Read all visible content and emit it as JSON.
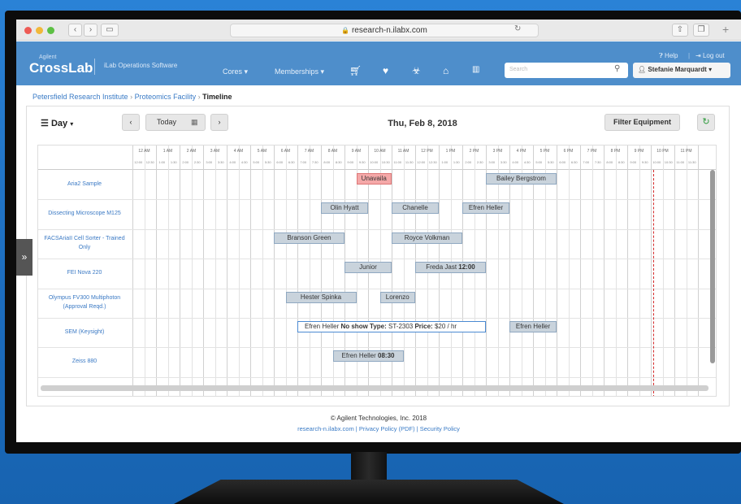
{
  "browser": {
    "url": "research-n.ilabx.com"
  },
  "app": {
    "brand_small": "Agilent",
    "brand": "CrossLab",
    "tagline": "iLab Operations Software",
    "nav": {
      "cores": "Cores",
      "memberships": "Memberships"
    },
    "help": "Help",
    "logout": "Log out",
    "search_placeholder": "Search",
    "user": "Stefanie Marquardt"
  },
  "breadcrumb": {
    "institute": "Petersfield Research Institute",
    "facility": "Proteomics Facility",
    "current": "Timeline"
  },
  "toolbar": {
    "view": "Day",
    "today": "Today",
    "date": "Thu, Feb 8, 2018",
    "filter": "Filter Equipment"
  },
  "timeline": {
    "hours": [
      "12 AM",
      "1 AM",
      "2 AM",
      "3 AM",
      "4 AM",
      "5 AM",
      "6 AM",
      "7 AM",
      "8 AM",
      "9 AM",
      "10 AM",
      "11 AM",
      "12 PM",
      "1 PM",
      "2 PM",
      "3 PM",
      "4 PM",
      "5 PM",
      "6 PM",
      "7 PM",
      "8 PM",
      "9 PM",
      "10 PM",
      "11 PM"
    ],
    "halves": [
      "12:00",
      "12:30",
      "1:00",
      "1:30",
      "2:00",
      "2:30",
      "3:00",
      "3:30",
      "4:00",
      "4:30",
      "5:00",
      "5:30",
      "6:00",
      "6:30",
      "7:00",
      "7:30",
      "8:00",
      "8:30",
      "9:00",
      "9:30",
      "10:00",
      "10:30",
      "11:00",
      "11:30",
      "12:00",
      "12:30",
      "1:00",
      "1:30",
      "2:00",
      "2:30",
      "3:00",
      "3:30",
      "4:00",
      "4:30",
      "5:00",
      "5:30",
      "6:00",
      "6:30",
      "7:00",
      "7:30",
      "8:00",
      "8:30",
      "9:00",
      "9:30",
      "10:00",
      "10:30",
      "11:00",
      "11:30"
    ],
    "resources": [
      {
        "name": "Aria2 Sample"
      },
      {
        "name": "Dissecting Microscope M125"
      },
      {
        "name": "FACSAriaII Cell Sorter - Trained Only"
      },
      {
        "name": "FEI Nova 220"
      },
      {
        "name": "Olympus FV300 Multiphoton (Approval Reqd.)"
      },
      {
        "name": "SEM (Keysight)"
      },
      {
        "name": "Zeiss 880"
      }
    ],
    "bookings": [
      {
        "row": 0,
        "start": 9.5,
        "end": 11.0,
        "text": "Unavaila",
        "style": "red"
      },
      {
        "row": 0,
        "start": 15.0,
        "end": 18.0,
        "text": "Bailey Bergstrom"
      },
      {
        "row": 1,
        "start": 8.0,
        "end": 10.0,
        "text": "Olin Hyatt"
      },
      {
        "row": 1,
        "start": 11.0,
        "end": 13.0,
        "text": "Chanelle"
      },
      {
        "row": 1,
        "start": 14.0,
        "end": 16.0,
        "text": "Efren Heller"
      },
      {
        "row": 2,
        "start": 6.0,
        "end": 9.0,
        "text": "Branson Green"
      },
      {
        "row": 2,
        "start": 11.0,
        "end": 14.0,
        "text": "Royce Volkman"
      },
      {
        "row": 3,
        "start": 9.0,
        "end": 11.0,
        "text": "Junior"
      },
      {
        "row": 3,
        "start": 12.0,
        "end": 15.0,
        "text": "Freda Jast",
        "bold": "12:00"
      },
      {
        "row": 4,
        "start": 6.5,
        "end": 9.5,
        "text": "Hester Spinka"
      },
      {
        "row": 4,
        "start": 10.5,
        "end": 12.0,
        "text": "Lorenzo"
      },
      {
        "row": 5,
        "start": 7.0,
        "end": 15.0,
        "text": "Efren Heller",
        "style": "white",
        "extra": [
          [
            "No show"
          ],
          [
            "Type:",
            "ST-2303"
          ],
          [
            "Price:",
            "$20 / hr"
          ]
        ]
      },
      {
        "row": 5,
        "start": 16.0,
        "end": 18.0,
        "text": "Efren Heller"
      },
      {
        "row": 6,
        "start": 8.5,
        "end": 11.5,
        "text": "Efren Heller",
        "bold": "08:30"
      }
    ],
    "now_hour": 22.1
  },
  "footer": {
    "copyright": "© Agilent Technologies, Inc. 2018",
    "site": "research-n.ilabx.com",
    "privacy": "Privacy Policy (PDF)",
    "security": "Security Policy"
  }
}
